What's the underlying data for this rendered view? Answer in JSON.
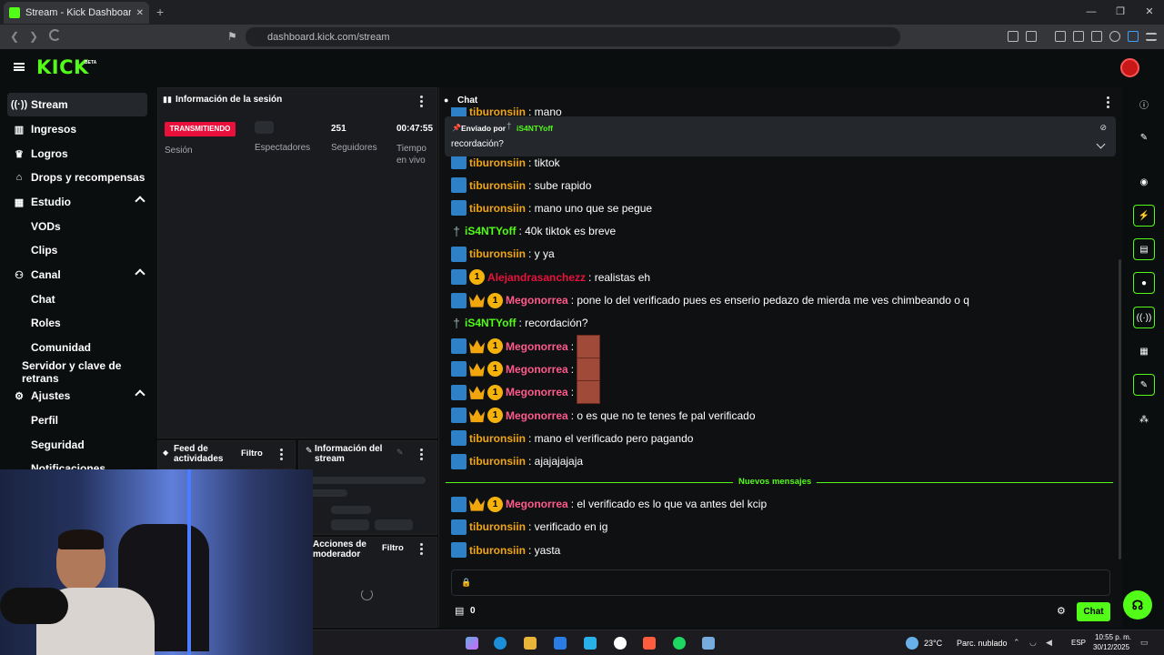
{
  "browser": {
    "tab_title": "Stream - Kick Dashboard",
    "new_tab": "+",
    "url": "dashboard.kick.com/stream",
    "window_controls": [
      "—",
      "❐",
      "✕"
    ]
  },
  "header": {
    "logo": "KICK",
    "beta": "BETA"
  },
  "sidebar": {
    "items": [
      {
        "label": "Stream",
        "icon": "broadcast-icon"
      },
      {
        "label": "Ingresos",
        "icon": "bank-icon"
      },
      {
        "label": "Logros",
        "icon": "trophy-icon"
      },
      {
        "label": "Drops y recompensas",
        "icon": "gift-icon"
      },
      {
        "label": "Estudio",
        "icon": "grid-icon"
      },
      {
        "label": "VODs"
      },
      {
        "label": "Clips"
      },
      {
        "label": "Canal",
        "icon": "people-icon"
      },
      {
        "label": "Chat"
      },
      {
        "label": "Roles"
      },
      {
        "label": "Comunidad"
      },
      {
        "label": "Servidor y clave de retrans"
      },
      {
        "label": "Ajustes",
        "icon": "gear-icon"
      },
      {
        "label": "Perfil"
      },
      {
        "label": "Seguridad"
      },
      {
        "label": "Notificaciones"
      }
    ]
  },
  "session": {
    "title": "Información de la sesión",
    "status_badge": "TRANSMITIENDO",
    "status_label": "Sesión",
    "stats": [
      {
        "value": "",
        "label": "Espectadores"
      },
      {
        "value": "251",
        "label": "Seguidores"
      },
      {
        "value": "00:47:55",
        "label": "Tiempo en vivo"
      }
    ]
  },
  "feed": {
    "title": "Feed de actividades",
    "filter": "Filtro"
  },
  "stream_info": {
    "title": "Información del stream"
  },
  "mod_actions": {
    "title": "Acciones de moderador",
    "filter": "Filtro"
  },
  "chat": {
    "title": "Chat",
    "pinned": {
      "sent_by": "Enviado por",
      "user": "iS4NTYoff",
      "text": "recordación?"
    },
    "partial_top": {
      "user": "tiburonsiin",
      "text": ": mano"
    },
    "partial_under": {
      "user": "tiburonsiin",
      "text": ": tiktok"
    },
    "messages": [
      {
        "badges": [
          "mod"
        ],
        "user": "tiburonsiin",
        "color": "tib",
        "text": ": sube rapido"
      },
      {
        "badges": [
          "mod"
        ],
        "user": "tiburonsiin",
        "color": "tib",
        "text": ": mano uno que se pegue"
      },
      {
        "badges": [
          "sword"
        ],
        "user": "iS4NTYoff",
        "color": "is4",
        "text": ": 40k tiktok es breve"
      },
      {
        "badges": [
          "mod"
        ],
        "user": "tiburonsiin",
        "color": "tib",
        "text": ": y ya"
      },
      {
        "badges": [
          "mod",
          "sub"
        ],
        "user": "Alejandrasanchezz",
        "color": "ale",
        "text": ": realistas eh"
      },
      {
        "badges": [
          "mod",
          "crown",
          "sub"
        ],
        "user": "Megonorrea",
        "color": "meg",
        "text": ": pone lo del verificado pues es enserio pedazo de mierda me ves chimbeando o q"
      },
      {
        "badges": [
          "sword"
        ],
        "user": "iS4NTYoff",
        "color": "is4",
        "text": ": recordación?"
      },
      {
        "badges": [
          "mod",
          "crown",
          "sub"
        ],
        "user": "Megonorrea",
        "color": "meg",
        "text": ":",
        "emote": true
      },
      {
        "badges": [
          "mod",
          "crown",
          "sub"
        ],
        "user": "Megonorrea",
        "color": "meg",
        "text": ":",
        "emote": true
      },
      {
        "badges": [
          "mod",
          "crown",
          "sub"
        ],
        "user": "Megonorrea",
        "color": "meg",
        "text": ":",
        "emote": true
      },
      {
        "badges": [
          "mod",
          "crown",
          "sub"
        ],
        "user": "Megonorrea",
        "color": "meg",
        "text": ": o es que no te tenes fe pal verificado"
      },
      {
        "badges": [
          "mod"
        ],
        "user": "tiburonsiin",
        "color": "tib",
        "text": ": mano el verificado pero pagando"
      },
      {
        "badges": [
          "mod"
        ],
        "user": "tiburonsiin",
        "color": "tib",
        "text": ": ajajajajaja"
      }
    ],
    "new_messages_label": "Nuevos mensajes",
    "new_messages": [
      {
        "badges": [
          "mod",
          "crown",
          "sub"
        ],
        "user": "Megonorrea",
        "color": "meg",
        "text": ": el verificado es lo que va antes del kcip"
      },
      {
        "badges": [
          "mod"
        ],
        "user": "tiburonsiin",
        "color": "tib",
        "text": ": verificado en ig"
      },
      {
        "badges": [
          "mod"
        ],
        "user": "tiburonsiin",
        "color": "tib",
        "text": ": yasta"
      }
    ],
    "sub_badge_number": "1",
    "viewer_count": "0",
    "send_button": "Chat"
  },
  "taskbar": {
    "weather": "23°C",
    "weather_desc": "Parc. nublado",
    "lang": "ESP",
    "time": "10:55 p. m.",
    "date": "30/12/2025"
  },
  "colors": {
    "accent": "#53fc18",
    "live": "#e9113c",
    "panel": "#191b1f"
  }
}
